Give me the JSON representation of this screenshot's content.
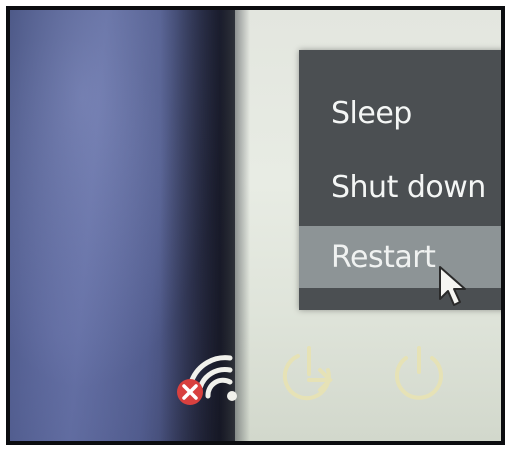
{
  "power_menu": {
    "items": [
      {
        "label": "Sleep"
      },
      {
        "label": "Shut down"
      },
      {
        "label": "Restart",
        "highlighted": true
      }
    ]
  },
  "bottom_bar": {
    "icons": [
      "wifi-disconnected-icon",
      "restart-icon",
      "power-icon"
    ]
  },
  "colors": {
    "menu_bg": "#4b4f52",
    "menu_highlight": "#8d9496",
    "menu_text": "#f4f6f5",
    "error_badge": "#d8403f",
    "icon_yellow": "#e6e2b6"
  }
}
